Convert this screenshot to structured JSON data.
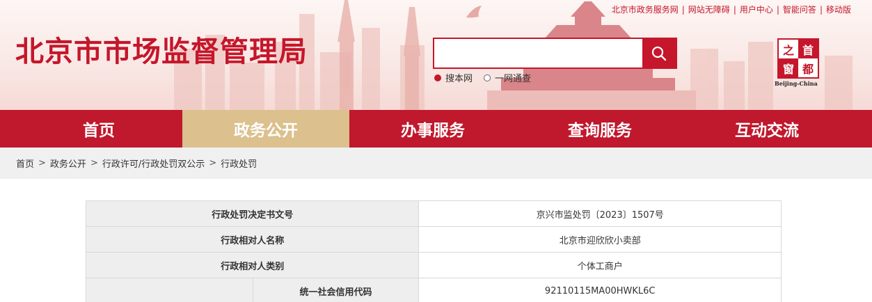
{
  "header": {
    "site_title": "北京市市场监督管理局",
    "top_links": [
      "北京市政务服务网",
      "网站无障碍",
      "用户中心",
      "智能问答",
      "移动版"
    ],
    "top_link_separator": "|",
    "search": {
      "placeholder": "",
      "button_icon": "search-icon",
      "scopes": [
        {
          "label": "搜本网",
          "selected": true
        },
        {
          "label": "一网通查",
          "selected": false
        }
      ]
    },
    "seal": {
      "chars": [
        "之",
        "首",
        "窗",
        "都"
      ],
      "caption": "Beijing-China"
    }
  },
  "nav": {
    "items": [
      {
        "label": "首页",
        "active": false
      },
      {
        "label": "政务公开",
        "active": true
      },
      {
        "label": "办事服务",
        "active": false
      },
      {
        "label": "查询服务",
        "active": false
      },
      {
        "label": "互动交流",
        "active": false
      }
    ]
  },
  "breadcrumb": {
    "items": [
      "首页",
      "政务公开",
      "行政许可/行政处罚双公示",
      "行政处罚"
    ],
    "separator": ">"
  },
  "record": {
    "rows": [
      {
        "label": "行政处罚决定书文号",
        "value": "京兴市监处罚〔2023〕1507号"
      },
      {
        "label": "行政相对人名称",
        "value": "北京市迎欣欣小卖部"
      },
      {
        "label": "行政相对人类别",
        "value": "个体工商户"
      },
      {
        "label": "统一社会信用代码",
        "value": "92110115MA00HWKL6C"
      }
    ]
  },
  "colors": {
    "brand_red": "#c0182c",
    "active_tab": "#dcc08d",
    "breadcrumb_bg": "#f0f0f0",
    "label_cell_bg": "#eeeeee"
  }
}
